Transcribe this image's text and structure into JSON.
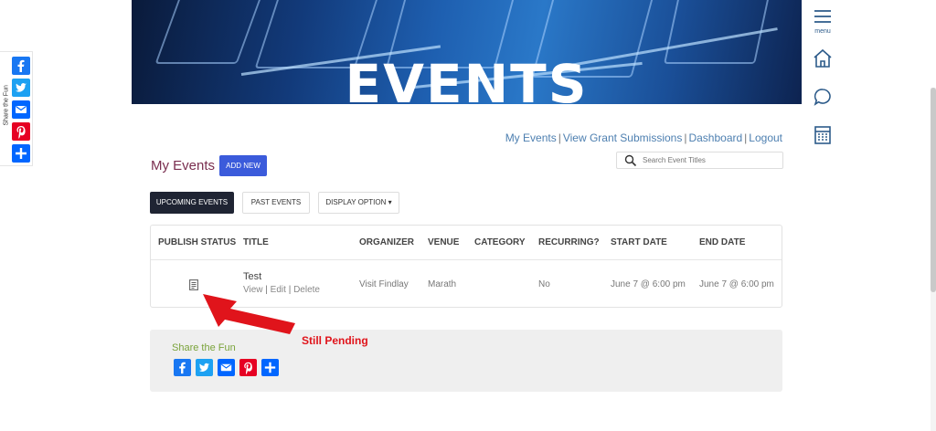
{
  "banner": {
    "title": "EVENTS"
  },
  "share_sidebar": {
    "label": "Share the Fun"
  },
  "nav": {
    "menu_label": "menu"
  },
  "toplinks": {
    "my_events": "My Events",
    "view_grant": "View Grant Submissions",
    "dashboard": "Dashboard",
    "logout": "Logout",
    "separator": "|"
  },
  "page": {
    "heading": "My Events",
    "add_new": "ADD NEW"
  },
  "search": {
    "placeholder": "Search Event Titles"
  },
  "tabs": {
    "upcoming": "UPCOMING EVENTS",
    "past": "PAST EVENTS",
    "display_option": "DISPLAY OPTION ▾"
  },
  "table": {
    "headers": {
      "publish_status": "PUBLISH STATUS",
      "title": "TITLE",
      "organizer": "ORGANIZER",
      "venue": "VENUE",
      "category": "CATEGORY",
      "recurring": "RECURRING?",
      "start_date": "START DATE",
      "end_date": "END DATE"
    },
    "rows": [
      {
        "title": "Test",
        "view": "View",
        "edit": "Edit",
        "delete": "Delete",
        "sep": "|",
        "organizer": "Visit Findlay",
        "venue": "Marath",
        "category": "",
        "recurring": "No",
        "start_date": "June 7 @ 6:00 pm",
        "end_date": "June 7 @ 6:00 pm"
      }
    ]
  },
  "annotation": {
    "text": "Still Pending"
  },
  "footer_share": {
    "label": "Share the Fun"
  },
  "colors": {
    "facebook": "#1877f2",
    "twitter": "#1da1f2",
    "email": "#0166ff",
    "pinterest": "#e60023",
    "share": "#0166ff",
    "accent": "#3b5bdb",
    "annotation": "#e0141b"
  },
  "icons": [
    "facebook-icon",
    "twitter-icon",
    "email-icon",
    "pinterest-icon",
    "share-plus-icon",
    "menu-icon",
    "home-icon",
    "chat-icon",
    "calendar-icon",
    "search-icon",
    "document-pending-icon"
  ]
}
